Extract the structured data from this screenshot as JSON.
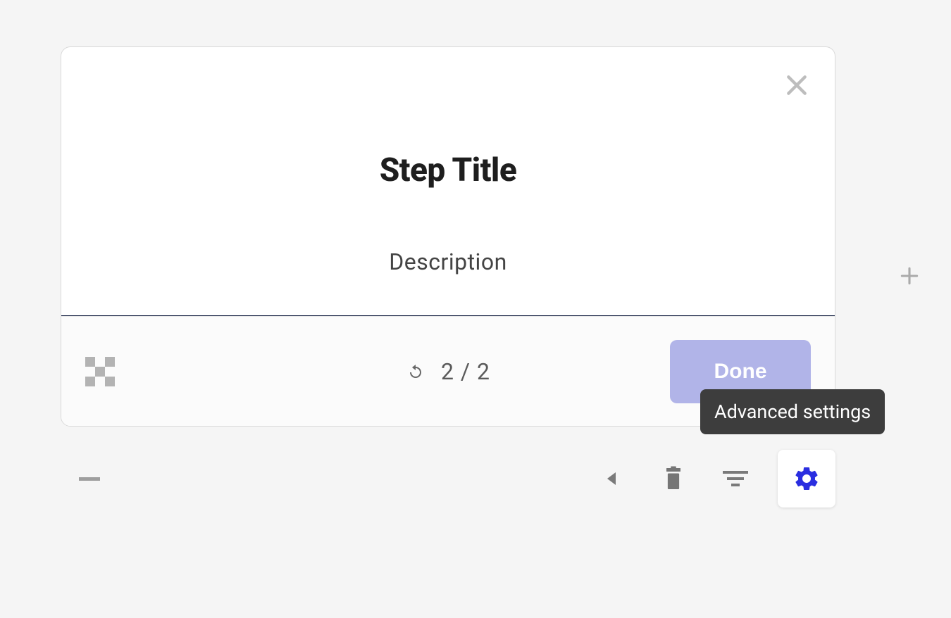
{
  "card": {
    "title": "Step Title",
    "description": "Description",
    "counter": "2 / 2",
    "doneLabel": "Done"
  },
  "tooltip": {
    "text": "Advanced settings"
  },
  "icons": {
    "close": "close-icon",
    "logo": "helpero-logo-icon",
    "restart": "restart-icon",
    "plus": "plus-icon",
    "minus": "minus-icon",
    "collapse": "collapse-left-icon",
    "trash": "trash-icon",
    "filter": "filter-icon",
    "gear": "gear-icon"
  },
  "colors": {
    "accent": "#2a2ee0",
    "doneButton": "#b1b4e8",
    "tooltipBg": "#3d3d3d",
    "cardBg": "#ffffff",
    "pageBg": "#f5f5f5"
  }
}
